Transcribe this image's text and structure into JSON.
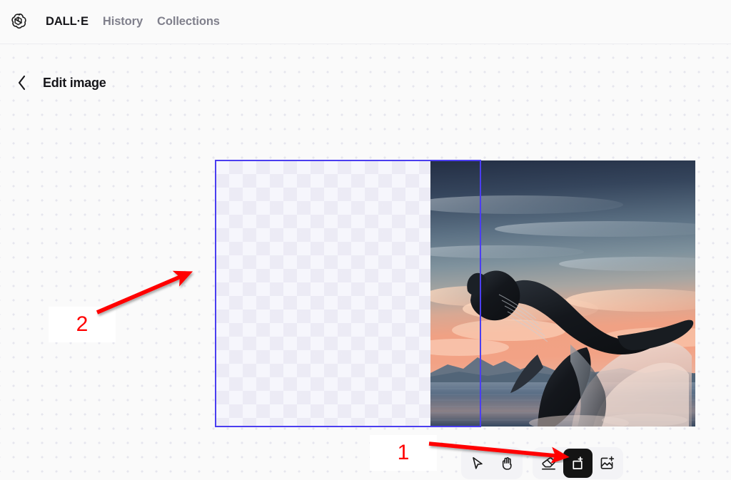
{
  "nav": {
    "logo_icon": "openai-logo-icon",
    "items": [
      {
        "label": "DALL·E",
        "state": "active"
      },
      {
        "label": "History",
        "state": "inactive"
      },
      {
        "label": "Collections",
        "state": "inactive"
      }
    ]
  },
  "header": {
    "back_icon": "chevron-left-icon",
    "title": "Edit image"
  },
  "canvas": {
    "background": "#fafafa",
    "dot_color": "#e6e6ee",
    "selection_color": "#4b3ef0",
    "transparent_area_label": "transparent-canvas-checkerboard",
    "image_alt": "Humpback whale breaching out of the ocean at sunset with mountains on the horizon",
    "image_colors": {
      "sky_top": "#2e3a52",
      "sky_mid": "#7d8e9c",
      "sunset": "#f0a184",
      "sunset_deep": "#ef9b7c",
      "ocean": "#4b5e74",
      "whale": "#16161a",
      "mountains": "#5b6d7e",
      "spray": "#e7c5bb"
    }
  },
  "toolbar": {
    "groups": [
      {
        "name": "navigation-tools",
        "tools": [
          {
            "icon": "cursor-select-icon",
            "label": "Select",
            "active": false
          },
          {
            "icon": "hand-pan-icon",
            "label": "Pan",
            "active": false
          }
        ]
      },
      {
        "name": "edit-tools",
        "tools": [
          {
            "icon": "eraser-icon",
            "label": "Eraser",
            "active": false
          },
          {
            "icon": "crop-expand-icon",
            "label": "Crop / Expand",
            "active": true
          },
          {
            "icon": "add-image-icon",
            "label": "Add image",
            "active": false
          }
        ]
      }
    ]
  },
  "annotations": {
    "color": "#ff0000",
    "markers": [
      {
        "label": "1",
        "target": "crop-expand-tool"
      },
      {
        "label": "2",
        "target": "expanded-transparent-canvas"
      }
    ]
  }
}
